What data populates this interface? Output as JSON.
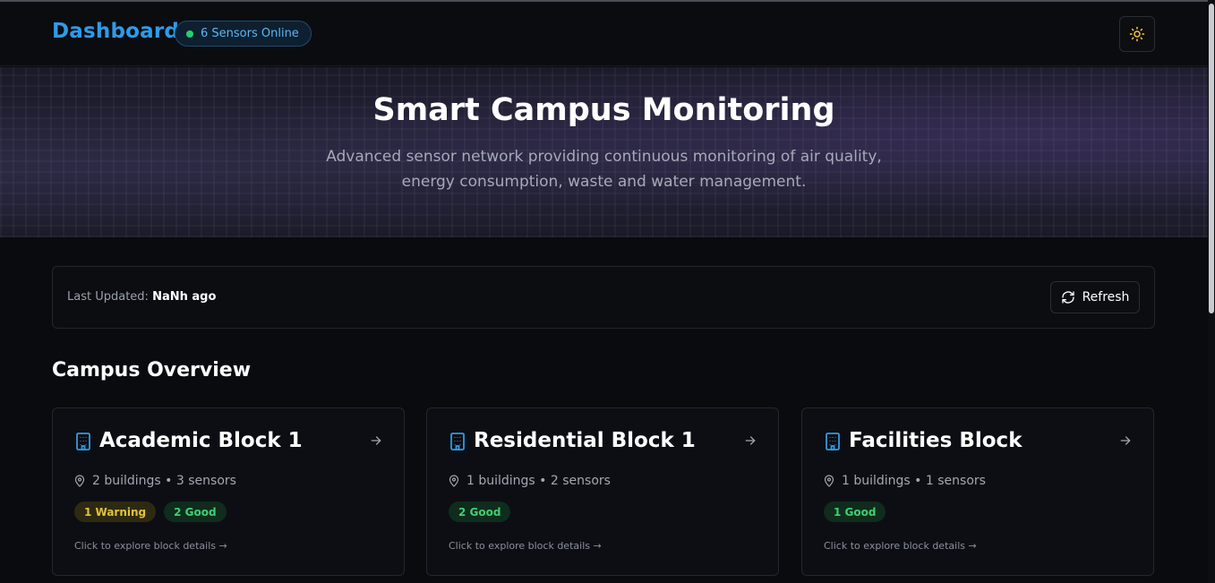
{
  "header": {
    "brand": "Dashboard",
    "sensors_online": "6 Sensors Online",
    "online_color": "#22d36b",
    "theme_icon": "sun-icon"
  },
  "hero": {
    "title": "Smart Campus Monitoring",
    "subtitle": "Advanced sensor network providing continuous monitoring of air quality, energy consumption, waste and water management."
  },
  "status": {
    "last_updated_label": "Last Updated:",
    "last_updated_value": "NaNh ago",
    "refresh_label": "Refresh",
    "refresh_icon": "refresh-icon"
  },
  "overview": {
    "title": "Campus Overview",
    "blocks": [
      {
        "name": "Academic Block 1",
        "meta": "2 buildings • 3 sensors",
        "badges": [
          {
            "label": "1 Warning",
            "type": "warning"
          },
          {
            "label": "2 Good",
            "type": "good"
          }
        ],
        "hint": "Click to explore block details →"
      },
      {
        "name": "Residential Block 1",
        "meta": "1 buildings • 2 sensors",
        "badges": [
          {
            "label": "2 Good",
            "type": "good"
          }
        ],
        "hint": "Click to explore block details →"
      },
      {
        "name": "Facilities Block",
        "meta": "1 buildings • 1 sensors",
        "badges": [
          {
            "label": "1 Good",
            "type": "good"
          }
        ],
        "hint": "Click to explore block details →"
      }
    ]
  },
  "colors": {
    "accent": "#2f9be8",
    "warning": "#e2c23a",
    "good": "#3fcf72",
    "background": "#0a0b0f"
  }
}
